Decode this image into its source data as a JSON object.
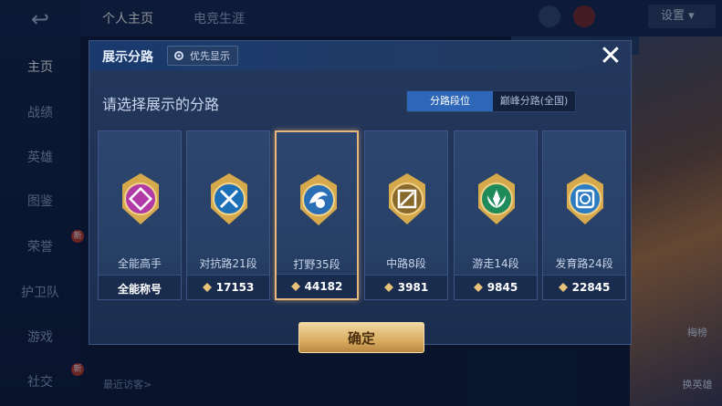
{
  "sidebar": {
    "back_label": "↩",
    "items": [
      {
        "label": "主页",
        "active": true
      },
      {
        "label": "战绩"
      },
      {
        "label": "英雄"
      },
      {
        "label": "图鉴"
      },
      {
        "label": "荣誉"
      },
      {
        "label": "护卫队"
      },
      {
        "label": "游戏"
      },
      {
        "label": "社交"
      }
    ],
    "badge": "新"
  },
  "topbar": {
    "tabs": [
      "个人主页",
      "电竞生涯"
    ],
    "settings_label": "设置"
  },
  "bottom": {
    "visitors_label": "最近访客>"
  },
  "right_buttons": [
    {
      "label": "梅榜"
    },
    {
      "label": "换英雄"
    }
  ],
  "modal": {
    "title": "展示分路",
    "priority_label": "优先显示",
    "close_label": "✕",
    "subtitle": "请选择展示的分路",
    "segments": [
      {
        "label": "分路段位",
        "active": true
      },
      {
        "label": "巅峰分路(全国)",
        "active": false
      }
    ],
    "cards": [
      {
        "label": "全能高手",
        "value": "全能称号",
        "icon": "all-round-medal-icon",
        "color": "#b13aa6",
        "selected": false,
        "has_diamond": false
      },
      {
        "label": "对抗路21段",
        "value": "17153",
        "icon": "clash-lane-medal-icon",
        "color": "#1d6fb8",
        "selected": false,
        "has_diamond": true
      },
      {
        "label": "打野35段",
        "value": "44182",
        "icon": "jungle-medal-icon",
        "color": "#2a6fb6",
        "selected": true,
        "has_diamond": true
      },
      {
        "label": "中路8段",
        "value": "3981",
        "icon": "mid-lane-medal-icon",
        "color": "#8a6a2c",
        "selected": false,
        "has_diamond": true
      },
      {
        "label": "游走14段",
        "value": "9845",
        "icon": "roam-medal-icon",
        "color": "#1f8a5a",
        "selected": false,
        "has_diamond": true
      },
      {
        "label": "发育路24段",
        "value": "22845",
        "icon": "farm-lane-medal-icon",
        "color": "#2b7cc2",
        "selected": false,
        "has_diamond": true
      }
    ],
    "confirm_label": "确定"
  },
  "colors": {
    "accent_gold": "#e9b77a",
    "active_tab": "#2e67b8"
  }
}
